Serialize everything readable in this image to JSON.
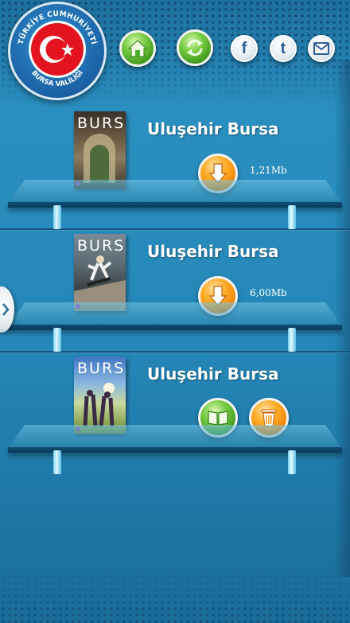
{
  "header": {
    "seal": {
      "top_text": "TÜRKİYE CUMHURİYETİ",
      "bottom_text": "BURSA VALİLİĞİ"
    },
    "buttons": [
      {
        "name": "home-button",
        "icon": "home-icon"
      },
      {
        "name": "refresh-button",
        "icon": "refresh-icon"
      },
      {
        "name": "facebook-button",
        "icon": "facebook-icon",
        "label": "f"
      },
      {
        "name": "twitter-button",
        "icon": "twitter-icon",
        "label": "t"
      },
      {
        "name": "mail-button",
        "icon": "mail-icon"
      }
    ]
  },
  "magazines": [
    {
      "title": "Uluşehir Bursa",
      "cover_text": "BURSA",
      "size": "1,21Mb",
      "action": "download"
    },
    {
      "title": "Uluşehir Bursa",
      "cover_text": "BURSA",
      "size": "6,00Mb",
      "action": "download"
    },
    {
      "title": "Uluşehir Bursa",
      "cover_text": "BURSA",
      "size": "",
      "action": "read-delete"
    }
  ],
  "colors": {
    "background": "#2587b8",
    "green": "#4caf2a",
    "orange": "#f28a00",
    "flag_red": "#e3141f"
  }
}
